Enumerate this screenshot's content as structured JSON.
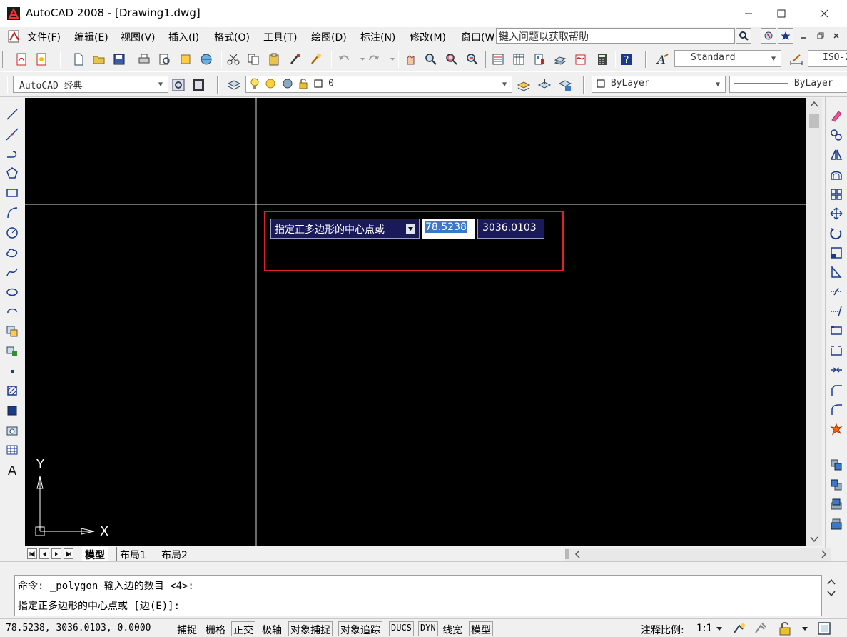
{
  "window": {
    "title": "AutoCAD 2008 - [Drawing1.dwg]"
  },
  "menu": {
    "items": [
      "文件(F)",
      "编辑(E)",
      "视图(V)",
      "插入(I)",
      "格式(O)",
      "工具(T)",
      "绘图(D)",
      "标注(N)",
      "修改(M)",
      "窗口(W"
    ],
    "help_placeholder": "键入问题以获取帮助"
  },
  "toolbar": {
    "text_style": "Standard",
    "dim_style": "ISO-2",
    "workspace": "AutoCAD 经典",
    "layer": "0",
    "color": "ByLayer",
    "linetype": "ByLayer"
  },
  "dynamic_input": {
    "prompt": "指定正多边形的中心点或",
    "x_value": "78.5238",
    "y_value": "3036.0103"
  },
  "ucs": {
    "x_label": "X",
    "y_label": "Y"
  },
  "layout_tabs": [
    "模型",
    "布局1",
    "布局2"
  ],
  "command": {
    "line1": "命令: _polygon 输入边的数目 <4>:",
    "line2": "指定正多边形的中心点或 [边(E)]:"
  },
  "status": {
    "coords": "78.5238,      3036.0103, 0.0000",
    "buttons": [
      "捕捉",
      "栅格",
      "正交",
      "极轴",
      "对象捕捉",
      "对象追踪",
      "DUCS",
      "DYN",
      "线宽",
      "模型"
    ],
    "annotation_scale_label": "注释比例:",
    "annotation_scale": "1:1"
  },
  "colors": {
    "canvas": "#000000",
    "dyn_prompt_bg": "#1a1a5a",
    "highlight": "#e0202a",
    "selection": "#3a78c8"
  }
}
